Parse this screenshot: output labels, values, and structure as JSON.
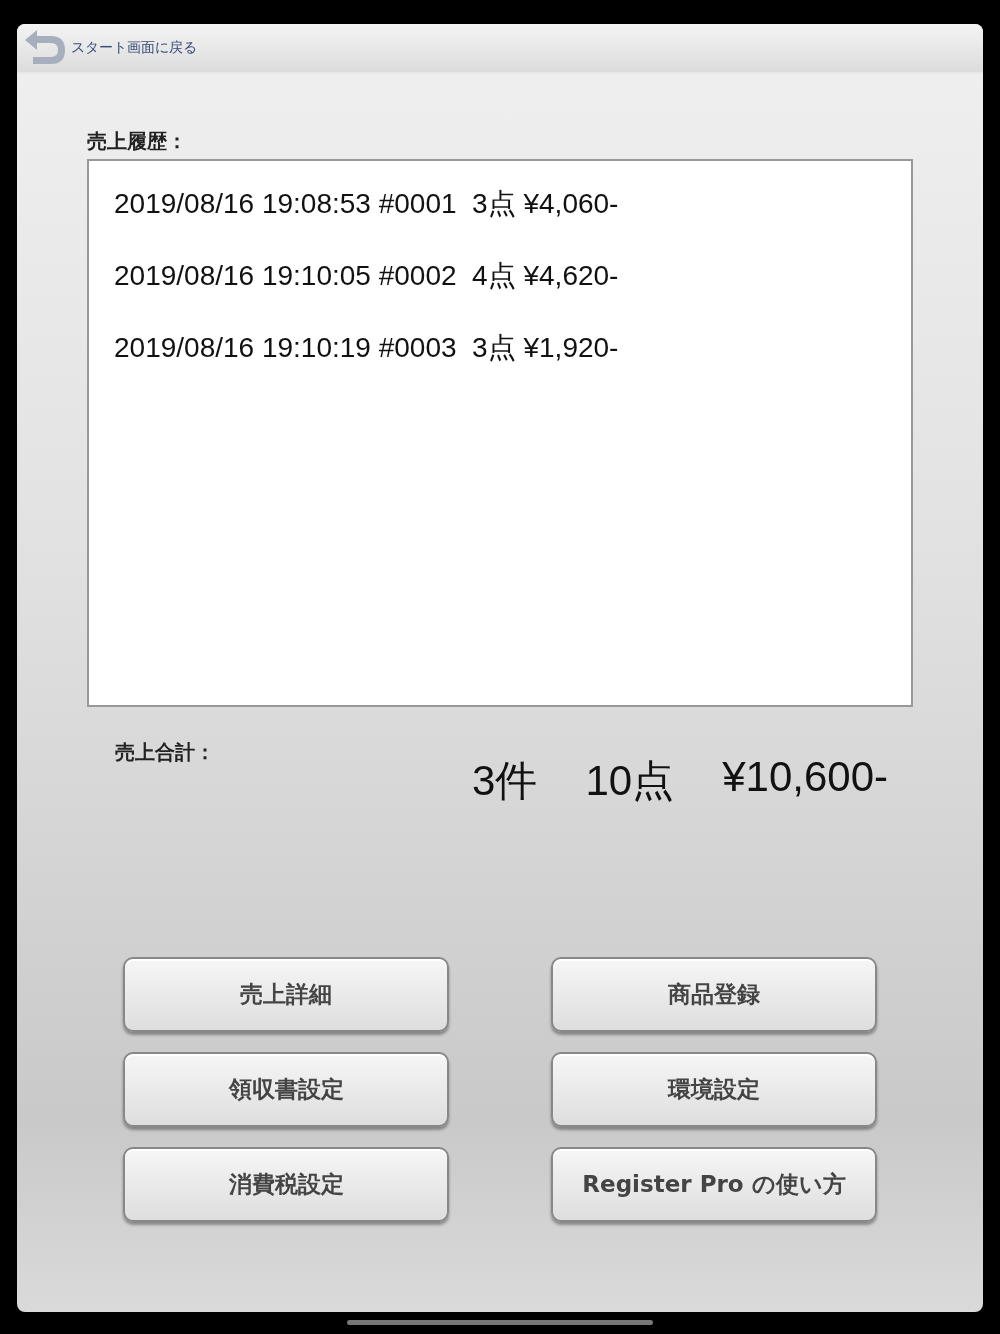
{
  "header": {
    "back_label": "スタート画面に戻る"
  },
  "history": {
    "label": "売上履歴：",
    "entries": [
      "2019/08/16 19:08:53 #0001  3点 ¥4,060-",
      "2019/08/16 19:10:05 #0002  4点 ¥4,620-",
      "2019/08/16 19:10:19 #0003  3点 ¥1,920-"
    ]
  },
  "total": {
    "label": "売上合計：",
    "count": "3件",
    "items": "10点",
    "amount": "¥10,600-"
  },
  "buttons": [
    "売上詳細",
    "商品登録",
    "領収書設定",
    "環境設定",
    "消費税設定",
    "Register Pro の使い方"
  ]
}
